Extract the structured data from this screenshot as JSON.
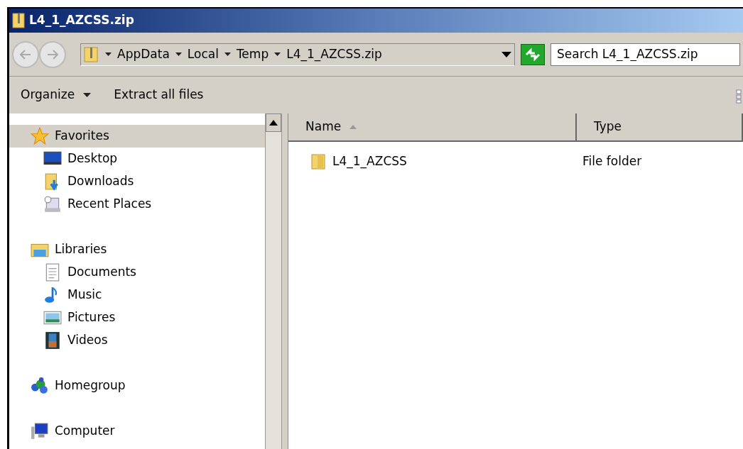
{
  "window": {
    "title": "L4_1_AZCSS.zip"
  },
  "address": {
    "segments": [
      "AppData",
      "Local",
      "Temp",
      "L4_1_AZCSS.zip"
    ]
  },
  "search": {
    "placeholder": "Search L4_1_AZCSS.zip"
  },
  "toolbar": [
    {
      "label": "Organize",
      "dropdown": true
    },
    {
      "label": "Extract all files",
      "dropdown": false
    }
  ],
  "navigation": [
    {
      "label": "Favorites",
      "kind": "star",
      "selected": true,
      "children": [
        {
          "label": "Desktop",
          "kind": "desktop",
          "selected": false
        },
        {
          "label": "Downloads",
          "kind": "downloads",
          "selected": false
        },
        {
          "label": "Recent Places",
          "kind": "recent",
          "selected": false
        }
      ]
    },
    {
      "label": "Libraries",
      "kind": "library",
      "selected": false,
      "children": [
        {
          "label": "Documents",
          "kind": "document",
          "selected": false
        },
        {
          "label": "Music",
          "kind": "music",
          "selected": false
        },
        {
          "label": "Pictures",
          "kind": "pictures",
          "selected": false
        },
        {
          "label": "Videos",
          "kind": "videos",
          "selected": false
        }
      ]
    },
    {
      "label": "Homegroup",
      "kind": "homegroup",
      "selected": false
    },
    {
      "label": "Computer",
      "kind": "computer",
      "selected": false
    }
  ],
  "table": {
    "columns": [
      {
        "label": "Name",
        "sorted": true
      },
      {
        "label": "Type",
        "sorted": false
      }
    ],
    "rows": [
      {
        "name": "L4_1_AZCSS",
        "type": "File folder"
      }
    ]
  }
}
